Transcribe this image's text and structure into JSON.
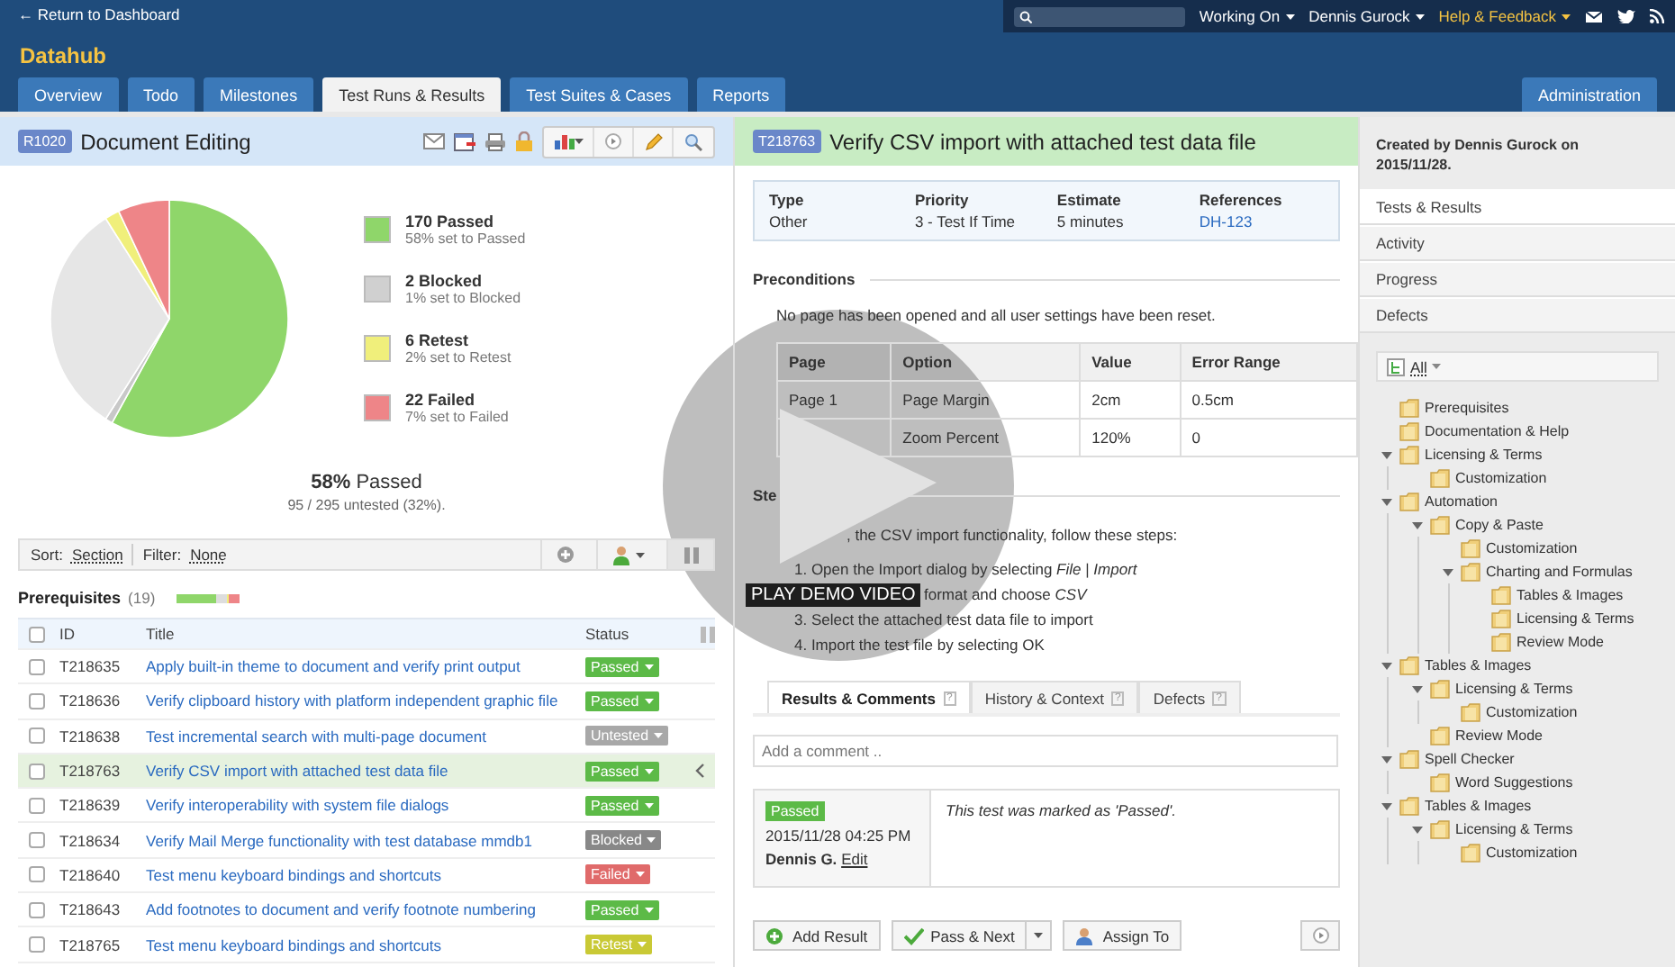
{
  "header": {
    "back_link": "← Return to Dashboard",
    "project": "Datahub",
    "menus": [
      {
        "label": "Working On",
        "highlighted": false
      },
      {
        "label": "Dennis Gurock",
        "highlighted": false
      },
      {
        "label": "Help & Feedback",
        "highlighted": true
      }
    ]
  },
  "tabs": [
    {
      "label": "Overview",
      "selected": false
    },
    {
      "label": "Todo",
      "selected": false
    },
    {
      "label": "Milestones",
      "selected": false
    },
    {
      "label": "Test Runs & Results",
      "selected": true
    },
    {
      "label": "Test Suites & Cases",
      "selected": false
    },
    {
      "label": "Reports",
      "selected": false
    }
  ],
  "admin_tab": "Administration",
  "run": {
    "id": "R1020",
    "title": "Document Editing",
    "chart_data": {
      "type": "pie",
      "values": [
        58,
        1,
        32,
        2,
        7
      ],
      "colors": [
        "#8fd66a",
        "#c8c8c8",
        "#e6e6e6",
        "#f0ef7b",
        "#ee8588"
      ]
    },
    "legend": [
      {
        "count": "170 Passed",
        "detail": "58% set to Passed",
        "color": "#8fd66a"
      },
      {
        "count": "2 Blocked",
        "detail": "1% set to Blocked",
        "color": "#d0d0d0"
      },
      {
        "count": "6 Retest",
        "detail": "2% set to Retest",
        "color": "#f0ef7b"
      },
      {
        "count": "22 Failed",
        "detail": "7% set to Failed",
        "color": "#ee8588"
      }
    ],
    "summary": {
      "percent": "58%",
      "label": "Passed",
      "untested": "95 / 295 untested (32%)."
    }
  },
  "toolbar": {
    "sort_label": "Sort:",
    "sort_value": "Section",
    "filter_label": "Filter:",
    "filter_value": "None"
  },
  "section": {
    "title": "Prerequisites",
    "count": "(19)"
  },
  "table": {
    "all_checked": false,
    "columns": [
      "ID",
      "Title",
      "Status"
    ],
    "rows": [
      {
        "id": "T218635",
        "title": "Apply built-in theme to document and verify print output",
        "status": "Passed",
        "kind": "passed",
        "selected": false,
        "checked": false
      },
      {
        "id": "T218636",
        "title": "Verify clipboard history with platform independent graphic file",
        "status": "Passed",
        "kind": "passed",
        "selected": false,
        "checked": false
      },
      {
        "id": "T218638",
        "title": "Test incremental search with multi-page document",
        "status": "Untested",
        "kind": "untested",
        "selected": false,
        "checked": false
      },
      {
        "id": "T218763",
        "title": "Verify CSV import with attached test data file",
        "status": "Passed",
        "kind": "passed",
        "selected": true,
        "checked": false
      },
      {
        "id": "T218639",
        "title": "Verify interoperability with system file dialogs",
        "status": "Passed",
        "kind": "passed",
        "selected": false,
        "checked": false
      },
      {
        "id": "T218634",
        "title": "Verify Mail Merge functionality with test database mmdb1",
        "status": "Blocked",
        "kind": "blocked",
        "selected": false,
        "checked": false
      },
      {
        "id": "T218640",
        "title": "Test menu keyboard bindings and shortcuts",
        "status": "Failed",
        "kind": "failed",
        "selected": false,
        "checked": false
      },
      {
        "id": "T218643",
        "title": "Add footnotes to document and verify footnote numbering",
        "status": "Passed",
        "kind": "passed",
        "selected": false,
        "checked": false
      },
      {
        "id": "T218765",
        "title": "Test menu keyboard bindings and shortcuts",
        "status": "Retest",
        "kind": "retest",
        "selected": false,
        "checked": false
      }
    ]
  },
  "case": {
    "id": "T218763",
    "title": "Verify CSV import with attached test data file",
    "fields": [
      {
        "label": "Type",
        "value": "Other",
        "kind": "text"
      },
      {
        "label": "Priority",
        "value": "3 - Test If Time",
        "kind": "text"
      },
      {
        "label": "Estimate",
        "value": "5 minutes",
        "kind": "text"
      },
      {
        "label": "References",
        "value": "DH-123",
        "kind": "link"
      }
    ],
    "preconditions": {
      "heading": "Preconditions",
      "text": "No page has been opened and all user settings have been reset.",
      "table": {
        "columns": [
          "Page",
          "Option",
          "Value",
          "Error Range"
        ],
        "rows": [
          [
            "Page 1",
            "Page Margin",
            "2cm",
            "0.5cm"
          ],
          [
            "",
            "Zoom Percent",
            "120%",
            "0"
          ]
        ]
      }
    },
    "steps": {
      "heading": "Ste",
      "intro": ", the CSV import functionality, follow these steps:",
      "items": [
        "1. Open the Import dialog by selecting *File* | *Import*",
        "format and choose *CSV*",
        "3. Select the attached test data file to import",
        "4. Import the test file by selecting OK"
      ]
    }
  },
  "result_tabs": [
    {
      "label": "Results & Comments",
      "help": "?",
      "selected": true
    },
    {
      "label": "History & Context",
      "help": "?",
      "selected": false
    },
    {
      "label": "Defects",
      "help": "?",
      "selected": false
    }
  ],
  "comment_field": {
    "placeholder": "Add a comment .."
  },
  "result": {
    "status": "Passed",
    "kind": "passed",
    "date": "2015/11/28 04:25 PM",
    "author": "Dennis G.",
    "edit_link": "Edit",
    "comment": "This test was marked as 'Passed'."
  },
  "buttons": [
    {
      "label": "Add Result",
      "kind": "add"
    },
    {
      "label": "Pass & Next",
      "kind": "pass"
    },
    {
      "label": "Assign To",
      "kind": "assign"
    }
  ],
  "video": {
    "label": "PLAY DEMO VIDEO"
  },
  "sidebar": {
    "created": "Created by Dennis Gurock on 2015/11/28.",
    "nav": [
      {
        "label": "Tests & Results",
        "selected": true
      },
      {
        "label": "Activity",
        "selected": false
      },
      {
        "label": "Progress",
        "selected": false
      },
      {
        "label": "Defects",
        "selected": false
      }
    ],
    "filter": "All",
    "tree": [
      {
        "label": "Prerequisites"
      },
      {
        "label": "Documentation & Help"
      },
      {
        "label": "Licensing & Terms",
        "expanded": true,
        "children": [
          {
            "label": "Customization"
          }
        ]
      },
      {
        "label": "Automation",
        "expanded": true,
        "children": [
          {
            "label": "Copy & Paste",
            "expanded": true,
            "children": [
              {
                "label": "Customization"
              },
              {
                "label": "Charting and Formulas",
                "expanded": true,
                "children": [
                  {
                    "label": "Tables & Images"
                  },
                  {
                    "label": "Licensing & Terms"
                  },
                  {
                    "label": "Review Mode"
                  }
                ]
              }
            ]
          }
        ]
      },
      {
        "label": "Tables & Images",
        "expanded": true,
        "children": [
          {
            "label": "Licensing & Terms",
            "expanded": true,
            "children": [
              {
                "label": "Customization"
              }
            ]
          },
          {
            "label": "Review Mode"
          }
        ]
      },
      {
        "label": "Spell Checker",
        "expanded": true,
        "children": [
          {
            "label": "Word Suggestions"
          }
        ]
      },
      {
        "label": "Tables & Images",
        "expanded": true,
        "children": [
          {
            "label": "Licensing & Terms",
            "expanded": true,
            "children": [
              {
                "label": "Customization"
              }
            ]
          }
        ]
      }
    ]
  }
}
